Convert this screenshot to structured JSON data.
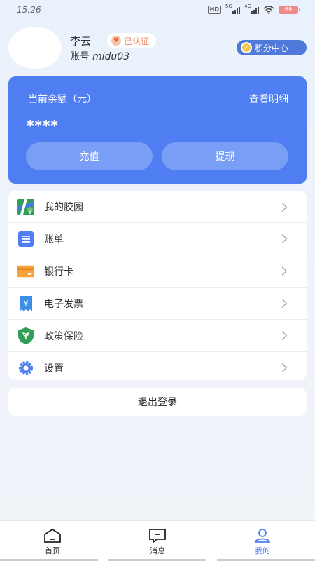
{
  "status_bar": {
    "time": "15:26",
    "hd": "HD",
    "net1": "5G",
    "net2": "4G",
    "battery": "69"
  },
  "profile": {
    "name": "李云",
    "verified": "已认证",
    "account_label": "账号",
    "account_id": "midu03",
    "points_center": "积分中心"
  },
  "balance": {
    "label": "当前余额（元）",
    "detail": "查看明细",
    "amount": "****",
    "recharge": "充值",
    "withdraw": "提现"
  },
  "menu": {
    "items": [
      {
        "label": "我的胶园",
        "icon": "map-tree-icon"
      },
      {
        "label": "账单",
        "icon": "bill-icon"
      },
      {
        "label": "银行卡",
        "icon": "bank-card-icon"
      },
      {
        "label": "电子发票",
        "icon": "invoice-icon"
      },
      {
        "label": "政策保险",
        "icon": "shield-icon"
      },
      {
        "label": "设置",
        "icon": "gear-icon"
      }
    ]
  },
  "logout": "退出登录",
  "tabs": [
    {
      "label": "首页",
      "icon": "home-icon"
    },
    {
      "label": "消息",
      "icon": "message-icon"
    },
    {
      "label": "我的",
      "icon": "user-icon",
      "active": true
    }
  ],
  "colors": {
    "primary": "#4e7ef2",
    "badge": "#f08a6a",
    "points_bg": "#4f7ad9"
  }
}
